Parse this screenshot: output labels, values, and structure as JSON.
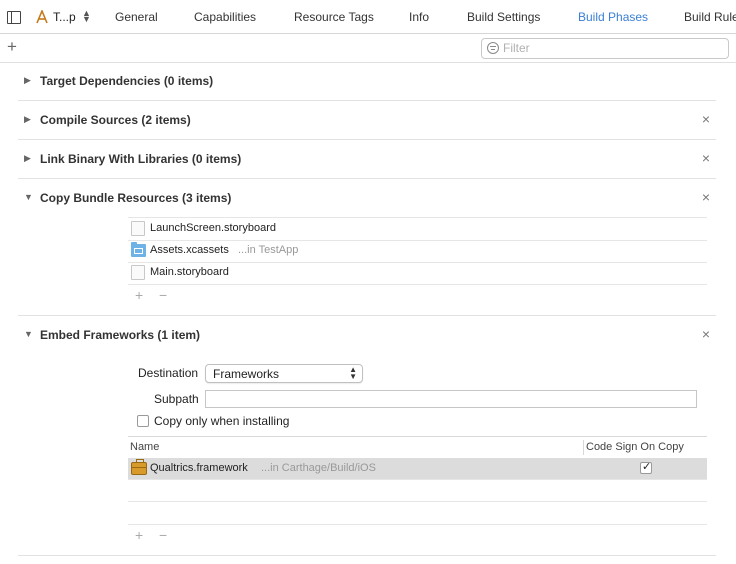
{
  "target": {
    "name": "T...p"
  },
  "tabs": [
    {
      "label": "General"
    },
    {
      "label": "Capabilities"
    },
    {
      "label": "Resource Tags"
    },
    {
      "label": "Info"
    },
    {
      "label": "Build Settings"
    },
    {
      "label": "Build Phases",
      "active": true
    },
    {
      "label": "Build Rule"
    }
  ],
  "toolbar": {
    "add_label": "+",
    "filter_placeholder": "Filter"
  },
  "phases": {
    "target_deps": {
      "title": "Target Dependencies (0 items)",
      "expanded": false
    },
    "compile": {
      "title": "Compile Sources (2 items)",
      "expanded": false,
      "close": "×"
    },
    "link": {
      "title": "Link Binary With Libraries (0 items)",
      "expanded": false,
      "close": "×"
    },
    "copy": {
      "title": "Copy Bundle Resources (3 items)",
      "expanded": true,
      "close": "×",
      "files": [
        {
          "name": "LaunchScreen.storyboard",
          "location": "",
          "icon": "storyboard-file-icon"
        },
        {
          "name": "Assets.xcassets",
          "location": "...in TestApp",
          "icon": "asset-catalog-icon"
        },
        {
          "name": "Main.storyboard",
          "location": "",
          "icon": "storyboard-file-icon"
        }
      ],
      "add": "+",
      "remove": "−"
    },
    "embed": {
      "title": "Embed Frameworks (1 item)",
      "expanded": true,
      "close": "×",
      "destination_label": "Destination",
      "destination_value": "Frameworks",
      "subpath_label": "Subpath",
      "subpath_value": "",
      "copy_only_label": "Copy only when installing",
      "copy_only_checked": false,
      "columns": {
        "name": "Name",
        "code_sign": "Code Sign On Copy"
      },
      "frameworks": [
        {
          "name": "Qualtrics.framework",
          "location": "...in Carthage/Build/iOS",
          "code_sign": true
        }
      ],
      "add": "+",
      "remove": "−"
    }
  },
  "colors": {
    "accent": "#3a7fd5",
    "selected_row": "#dcdcdc",
    "framework_icon": "#d79a2b",
    "folder_icon": "#6fb3e6"
  }
}
